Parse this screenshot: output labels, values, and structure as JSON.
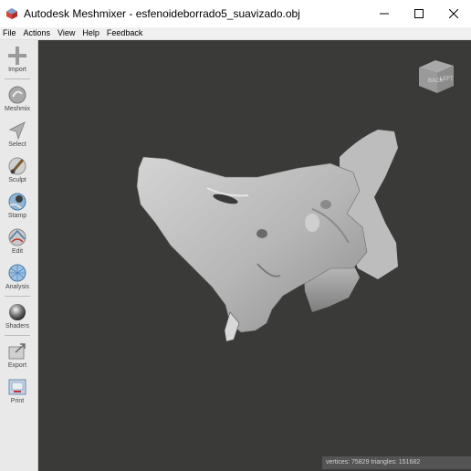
{
  "window": {
    "title": "Autodesk Meshmixer - esfenoideborrado5_suavizado.obj"
  },
  "menu": [
    "File",
    "Actions",
    "View",
    "Help",
    "Feedback"
  ],
  "toolbar": {
    "items": [
      {
        "label": "Import",
        "icon": "plus-icon"
      },
      {
        "label": "Meshmix",
        "icon": "meshmix-icon"
      },
      {
        "label": "Select",
        "icon": "arrow-icon"
      },
      {
        "label": "Sculpt",
        "icon": "brush-icon"
      },
      {
        "label": "Stamp",
        "icon": "stamp-icon"
      },
      {
        "label": "Edit",
        "icon": "edit-icon"
      },
      {
        "label": "Analysis",
        "icon": "analysis-icon"
      },
      {
        "label": "Shaders",
        "icon": "sphere-icon"
      },
      {
        "label": "Export",
        "icon": "export-icon"
      },
      {
        "label": "Print",
        "icon": "print-icon"
      }
    ]
  },
  "viewcube": {
    "faces": [
      "BACK",
      "LEFT"
    ]
  },
  "status": {
    "text": "vertices: 75829 triangles: 151682"
  },
  "colors": {
    "viewport_bg": "#3a3a39",
    "mesh": "#b8b8b8",
    "toolbar_bg": "#e9e9e9"
  }
}
